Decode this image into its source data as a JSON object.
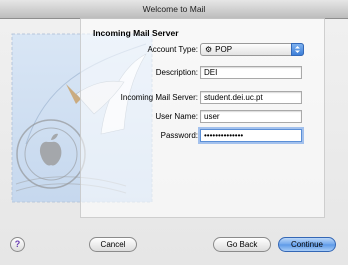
{
  "window": {
    "title": "Welcome to Mail"
  },
  "form": {
    "section_title": "Incoming Mail Server",
    "account_type": {
      "label": "Account Type:",
      "value": "POP",
      "icon": "gear-icon"
    },
    "description": {
      "label": "Description:",
      "value": "DEI"
    },
    "server": {
      "label": "Incoming Mail Server:",
      "value": "student.dei.uc.pt"
    },
    "username": {
      "label": "User Name:",
      "value": "user"
    },
    "password": {
      "label": "Password:",
      "value": "••••••••••••••"
    }
  },
  "buttons": {
    "help": "?",
    "cancel": "Cancel",
    "go_back": "Go Back",
    "continue": "Continue"
  },
  "colors": {
    "focus": "#5b8fd6",
    "default_button": "#6fa6ec"
  }
}
